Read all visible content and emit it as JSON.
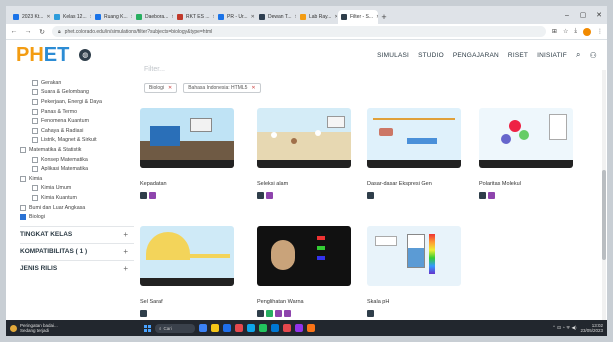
{
  "browser": {
    "tabs": [
      {
        "label": "2023 Kt...",
        "color": "#1a73e8"
      },
      {
        "label": "Kelas 12...",
        "color": "#2d9cdb"
      },
      {
        "label": "Ruang K...",
        "color": "#1a73e8"
      },
      {
        "label": "Daebora...",
        "color": "#27ae60"
      },
      {
        "label": "RKT ES ...",
        "color": "#c0392b"
      },
      {
        "label": "PR - Ur...",
        "color": "#1a73e8"
      },
      {
        "label": "Dewan T...",
        "color": "#2d3e50"
      },
      {
        "label": "Lab Ray...",
        "color": "#f39c12"
      },
      {
        "label": "Filter - S...",
        "color": "#2f3e4a",
        "active": true
      }
    ],
    "new_tab": "+",
    "window_controls": [
      "‒",
      "▢",
      "✕"
    ],
    "url": "phet.colorado.edu/in/simulations/filter?subjects=biology&type=html",
    "nav": {
      "back": "←",
      "forward": "→",
      "reload": "↻"
    },
    "addr_icons": {
      "translate": "⊞",
      "star": "☆",
      "download": "⤓",
      "menu": "⋮"
    }
  },
  "header": {
    "logo_ph": "PH",
    "logo_et": "ET",
    "menu": [
      "SIMULASI",
      "STUDIO",
      "PENGAJARAN",
      "RISET",
      "INISIATIF"
    ],
    "search_icon": "⌕",
    "user_icon": "⚇"
  },
  "search": {
    "placeholder": "Filter..."
  },
  "filters": [
    {
      "label": "Biologi",
      "x": "✕"
    },
    {
      "label": "Bahasa Indonesia: HTML5",
      "x": "✕"
    }
  ],
  "sidebar": {
    "items": [
      {
        "label": "Gerakan",
        "sub": true
      },
      {
        "label": "Suara & Gelombang",
        "sub": true
      },
      {
        "label": "Pekerjaan, Energi & Daya",
        "sub": true
      },
      {
        "label": "Panas & Termo",
        "sub": true
      },
      {
        "label": "Fenomena Kuantum",
        "sub": true
      },
      {
        "label": "Cahaya & Radiasi",
        "sub": true
      },
      {
        "label": "Listrik, Magnet & Sirkuit",
        "sub": true
      },
      {
        "label": "Matematika & Statistik",
        "sub": false
      },
      {
        "label": "Konsep Matematika",
        "sub": true
      },
      {
        "label": "Aplikasi Matematika",
        "sub": true
      },
      {
        "label": "Kimia",
        "sub": false
      },
      {
        "label": "Kimia Umum",
        "sub": true
      },
      {
        "label": "Kimia Kuantum",
        "sub": true
      },
      {
        "label": "Bumi dan Luar Angkasa",
        "sub": false
      },
      {
        "label": "Biologi",
        "sub": false,
        "checked": true
      }
    ],
    "accordions": [
      {
        "label": "TINGKAT KELAS",
        "icon": "+"
      },
      {
        "label": "KOMPATIBILITAS ( 1 )",
        "icon": "+"
      },
      {
        "label": "JENIS RILIS",
        "icon": "+"
      }
    ]
  },
  "simulations": [
    {
      "title": "Kepadatan",
      "icons": [
        "#2f3e4a",
        "#8e44ad"
      ]
    },
    {
      "title": "Seleksi alam",
      "icons": [
        "#2f3e4a",
        "#8e44ad"
      ]
    },
    {
      "title": "Dasar-dasar Ekspresi Gen",
      "icons": [
        "#2f3e4a"
      ]
    },
    {
      "title": "Polaritas Molekul",
      "icons": [
        "#2f3e4a",
        "#8e44ad"
      ]
    },
    {
      "title": "Sel Saraf",
      "icons": [
        "#2f3e4a"
      ]
    },
    {
      "title": "Penglihatan Warna",
      "icons": [
        "#2f3e4a",
        "#27ae60",
        "#8e44ad",
        "#8e44ad"
      ]
    },
    {
      "title": "Skala pH",
      "icons": [
        "#2f3e4a"
      ]
    }
  ],
  "taskbar": {
    "weather_line1": "Peringatan badai...",
    "weather_line2": "Sedang terjadi",
    "search_label": "Cari",
    "apps": [
      "#3b82f6",
      "#f5c518",
      "#1f6feb",
      "#e5484d",
      "#0ea5e9",
      "#22c55e",
      "#0078d4",
      "#e5484d",
      "#9333ea",
      "#f97316"
    ],
    "time": "13:02",
    "date": "23/05/2023",
    "tray": "⌃ ⊡ ◔ ᯤ ◀)"
  }
}
